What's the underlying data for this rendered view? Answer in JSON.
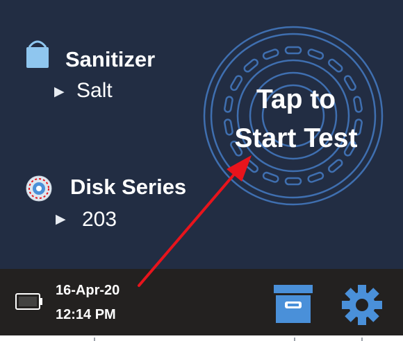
{
  "colors": {
    "screen_bg": "#222d43",
    "status_bg": "#232120",
    "accent_blue": "#4a90d9",
    "disk_outline": "#3f6fb0",
    "arrow_red": "#e8141c"
  },
  "sanitizer": {
    "label": "Sanitizer",
    "value": "Salt",
    "icon": "bucket-icon"
  },
  "disk": {
    "label": "Disk Series",
    "value": "203",
    "icon": "disk-icon"
  },
  "start": {
    "line1": "Tap to",
    "line2": "Start Test"
  },
  "status": {
    "date": "16-Apr-20",
    "time": "12:14 PM",
    "battery_icon": "battery-icon"
  },
  "buttons": {
    "archive_icon": "archive-icon",
    "settings_icon": "gear-icon"
  }
}
